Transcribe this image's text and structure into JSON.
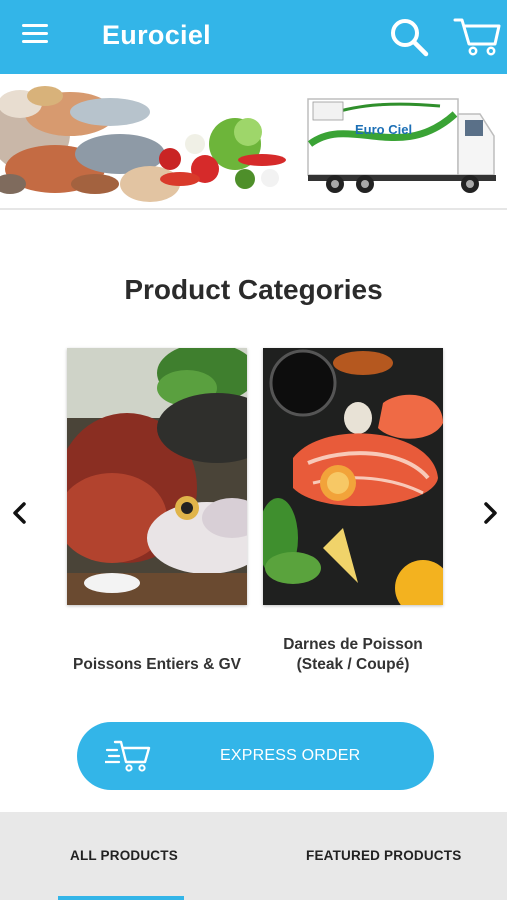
{
  "header": {
    "title": "Eurociel",
    "menu_icon": "hamburger-menu-icon",
    "search_icon": "search-icon",
    "cart_icon": "shopping-cart-icon",
    "bar_color": "#33b5e8"
  },
  "banner": {
    "truck_logo": "Euro Ciel"
  },
  "categories": {
    "title": "Product Categories",
    "items": [
      {
        "label": "Poissons Entiers & GV"
      },
      {
        "label_line1": "Darnes de Poisson",
        "label_line2": "(Steak / Coupé)"
      }
    ]
  },
  "express": {
    "label": "EXPRESS ORDER",
    "icon": "fast-cart-icon"
  },
  "tabs": {
    "items": [
      {
        "label": "ALL PRODUCTS",
        "active": true
      },
      {
        "label": "FEATURED PRODUCTS",
        "active": false
      }
    ]
  }
}
